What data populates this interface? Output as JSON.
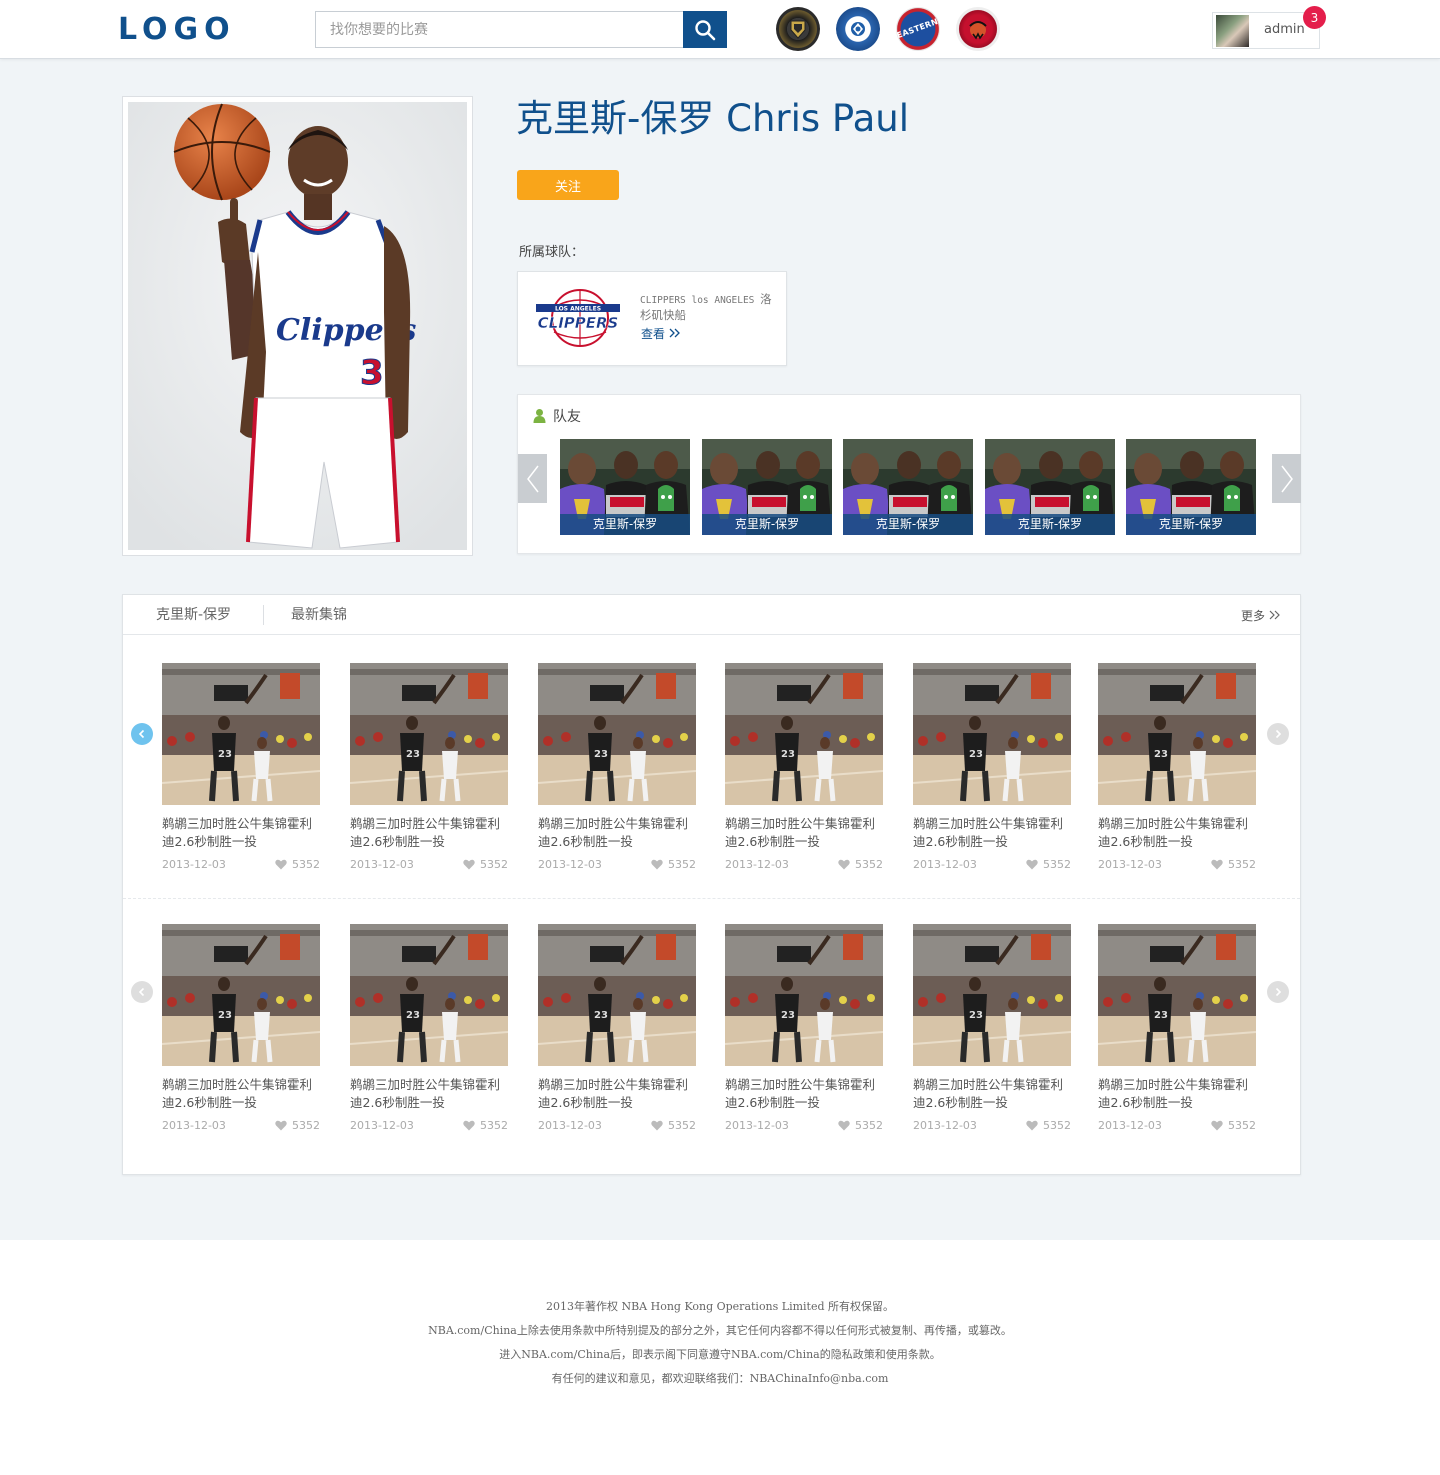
{
  "header": {
    "logo": "LOGO",
    "search_placeholder": "找你想要的比赛",
    "team_badges": [
      "cavaliers-badge",
      "hornets-badge",
      "eastern-badge",
      "raptors-badge"
    ],
    "user": {
      "name": "admin",
      "notifications": "3"
    }
  },
  "player": {
    "name": "克里斯-保罗 Chris Paul",
    "follow_label": "关注",
    "team_label": "所属球队：",
    "jersey_number": "3",
    "jersey_text": "Clippers",
    "team": {
      "name_en": "CLIPPERS los ANGELES",
      "name_cn": "洛杉矶快船",
      "view_label": "查看",
      "logo_top": "LOS ANGELES",
      "logo_main": "CLIPPERS"
    }
  },
  "teammates": {
    "title": "队友",
    "items": [
      "克里斯-保罗",
      "克里斯-保罗",
      "克里斯-保罗",
      "克里斯-保罗",
      "克里斯-保罗"
    ]
  },
  "highlights": {
    "tabs": [
      "克里斯-保罗",
      "最新集锦"
    ],
    "more_label": "更多",
    "row1": [
      {
        "title": "鹈鹕三加时胜公牛集锦霍利迪2.6秒制胜一投",
        "date": "2013-12-03",
        "likes": "5352"
      },
      {
        "title": "鹈鹕三加时胜公牛集锦霍利迪2.6秒制胜一投",
        "date": "2013-12-03",
        "likes": "5352"
      },
      {
        "title": "鹈鹕三加时胜公牛集锦霍利迪2.6秒制胜一投",
        "date": "2013-12-03",
        "likes": "5352"
      },
      {
        "title": "鹈鹕三加时胜公牛集锦霍利迪2.6秒制胜一投",
        "date": "2013-12-03",
        "likes": "5352"
      },
      {
        "title": "鹈鹕三加时胜公牛集锦霍利迪2.6秒制胜一投",
        "date": "2013-12-03",
        "likes": "5352"
      },
      {
        "title": "鹈鹕三加时胜公牛集锦霍利迪2.6秒制胜一投",
        "date": "2013-12-03",
        "likes": "5352"
      }
    ],
    "row2": [
      {
        "title": "鹈鹕三加时胜公牛集锦霍利迪2.6秒制胜一投",
        "date": "2013-12-03",
        "likes": "5352"
      },
      {
        "title": "鹈鹕三加时胜公牛集锦霍利迪2.6秒制胜一投",
        "date": "2013-12-03",
        "likes": "5352"
      },
      {
        "title": "鹈鹕三加时胜公牛集锦霍利迪2.6秒制胜一投",
        "date": "2013-12-03",
        "likes": "5352"
      },
      {
        "title": "鹈鹕三加时胜公牛集锦霍利迪2.6秒制胜一投",
        "date": "2013-12-03",
        "likes": "5352"
      },
      {
        "title": "鹈鹕三加时胜公牛集锦霍利迪2.6秒制胜一投",
        "date": "2013-12-03",
        "likes": "5352"
      },
      {
        "title": "鹈鹕三加时胜公牛集锦霍利迪2.6秒制胜一投",
        "date": "2013-12-03",
        "likes": "5352"
      }
    ],
    "thumb_jersey": "23"
  },
  "footer": {
    "lines": [
      "2013年著作权 NBA Hong Kong Operations Limited 所有权保留。",
      "NBA.com/China上除去使用条款中所特别提及的部分之外，其它任何内容都不得以任何形式被复制、再传播，或篡改。",
      "进入NBA.com/China后，即表示阁下同意遵守NBA.com/China的隐私政策和使用条款。",
      "有任何的建议和意见，都欢迎联络我们：NBAChinaInfo@nba.com"
    ]
  },
  "colors": {
    "brand_blue": "#10508c",
    "follow_orange": "#f9a51a",
    "notification_red": "#e41e4b",
    "active_arrow": "#6fc3ee"
  }
}
